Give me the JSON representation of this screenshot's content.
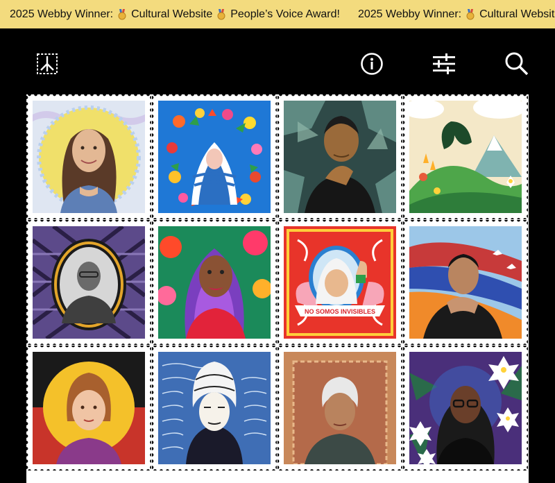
{
  "banner": {
    "segments": [
      {
        "prefix": "2025 Webby Winner:",
        "award1": "Cultural Website",
        "award2": "People’s Voice Award!"
      },
      {
        "prefix": "2025 Webby Winner:",
        "award1": "Cultural Website",
        "award2": ""
      }
    ]
  },
  "header": {
    "logo_icon": "peace-stamp-logo-icon",
    "info_icon": "info-icon",
    "filter_icon": "sliders-icon",
    "search_icon": "search-icon"
  },
  "stamps": [
    {
      "portrait": "woman-smiling-long-dark-hair",
      "style": "pencil-sketch-yellow-circle"
    },
    {
      "portrait": "woman-in-blue-striped-veil",
      "style": "floral-wreath-on-blue"
    },
    {
      "portrait": "man-hand-on-chin",
      "style": "teal-foliage"
    },
    {
      "portrait": "abstract-mountain-landscape",
      "style": "green-hills-flowers"
    },
    {
      "portrait": "man-in-suit-framed-oval",
      "style": "purple-woven-pattern"
    },
    {
      "portrait": "woman-long-purple-braids",
      "style": "tropical-flowers"
    },
    {
      "portrait": "woman-white-headscarf-raised-fist",
      "style": "ornate-red-frame",
      "ribbon_text": "NO SOMOS INVISIBLES"
    },
    {
      "portrait": "man-clasped-hands",
      "style": "flag-stripes-blue-sky"
    },
    {
      "portrait": "girl-short-hair-yellow-circle",
      "style": "red-black-band"
    },
    {
      "portrait": "woman-braided-hair-handwriting",
      "style": "blue-script-background"
    },
    {
      "portrait": "older-woman-white-hair",
      "style": "patterned-tan-frame"
    },
    {
      "portrait": "woman-glasses-white-flowers",
      "style": "purple-foliage"
    }
  ],
  "colors": {
    "banner_bg": "#f3db7e",
    "page_bg": "#000000",
    "sheet_bg": "#ffffff"
  }
}
